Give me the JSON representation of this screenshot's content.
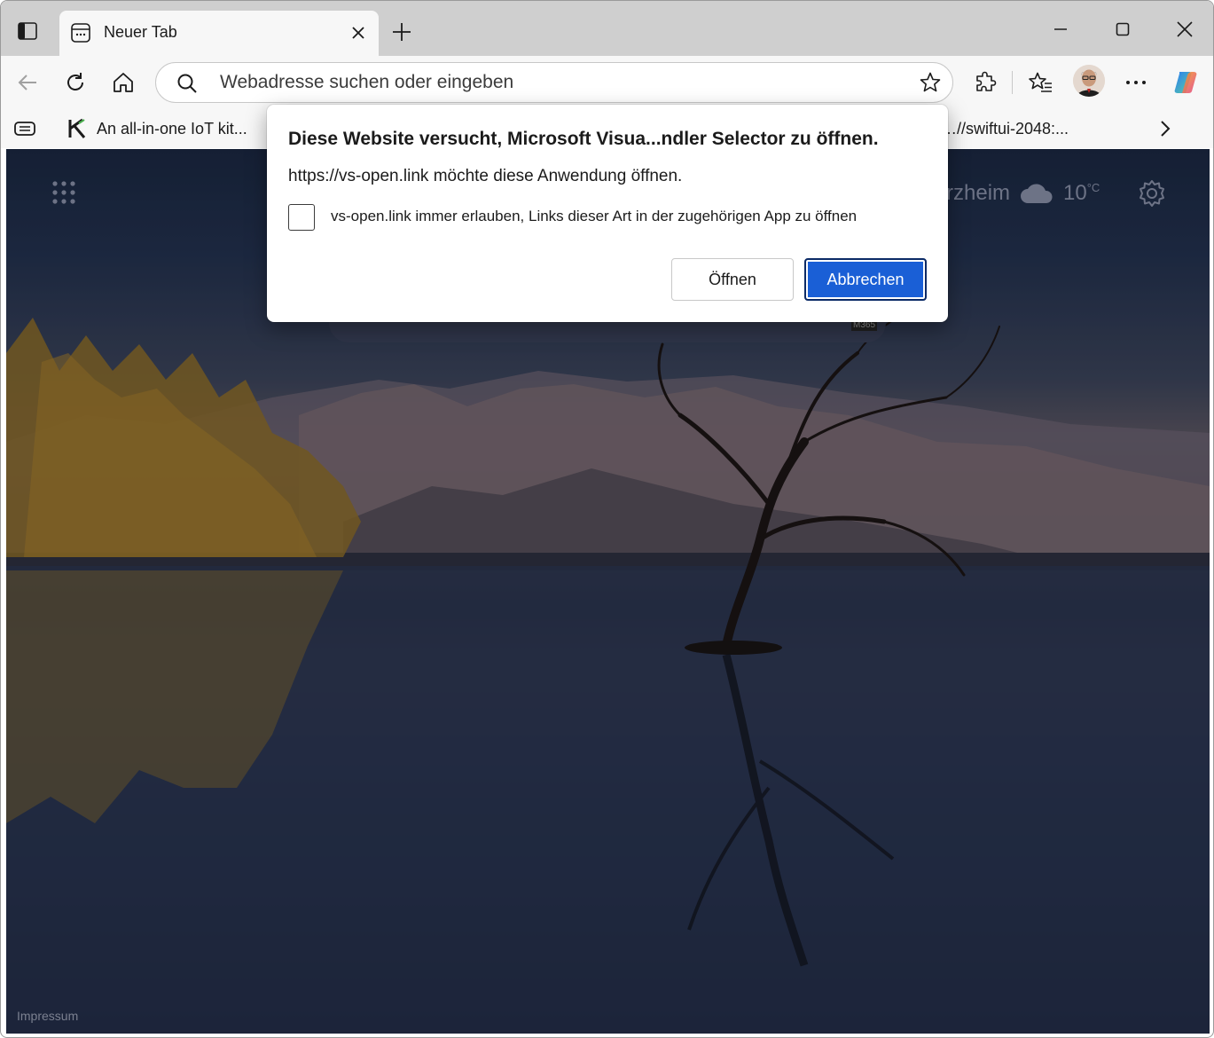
{
  "browser": {
    "tab": {
      "title": "Neuer Tab"
    },
    "address_bar": {
      "placeholder": "Webadresse suchen oder eingeben"
    },
    "favorites": [
      {
        "label": "An all-in-one IoT kit..."
      },
      {
        "label": "…//swiftui-2048:..."
      }
    ]
  },
  "page": {
    "weather": {
      "location": "rzheim",
      "temperature": "10",
      "unit": "°C"
    },
    "searchbox_badge": "M365",
    "footer_link": "Impressum"
  },
  "dialog": {
    "title": "Diese Website versucht, Microsoft Visua...ndler Selector zu öffnen.",
    "message": "https://vs-open.link möchte diese Anwendung öffnen.",
    "checkbox_label": "vs-open.link immer erlauben, Links dieser Art in der zugehörigen App zu öffnen",
    "checkbox_checked": false,
    "open_button": "Öffnen",
    "cancel_button": "Abbrechen"
  },
  "colors": {
    "accent": "#1a5fd6",
    "tabstrip_bg": "#cfcfcf",
    "toolbar_bg": "#f7f7f7"
  },
  "icons": [
    "tab-actions-icon",
    "tab-favicon",
    "close-icon",
    "plus-icon",
    "minimize-icon",
    "maximize-icon",
    "back-icon",
    "refresh-icon",
    "home-icon",
    "search-icon",
    "star-icon",
    "extensions-icon",
    "favorites-icon",
    "more-icon",
    "copilot-icon",
    "apps-grid-icon",
    "cloud-icon",
    "gear-icon",
    "chevron-right-icon"
  ]
}
